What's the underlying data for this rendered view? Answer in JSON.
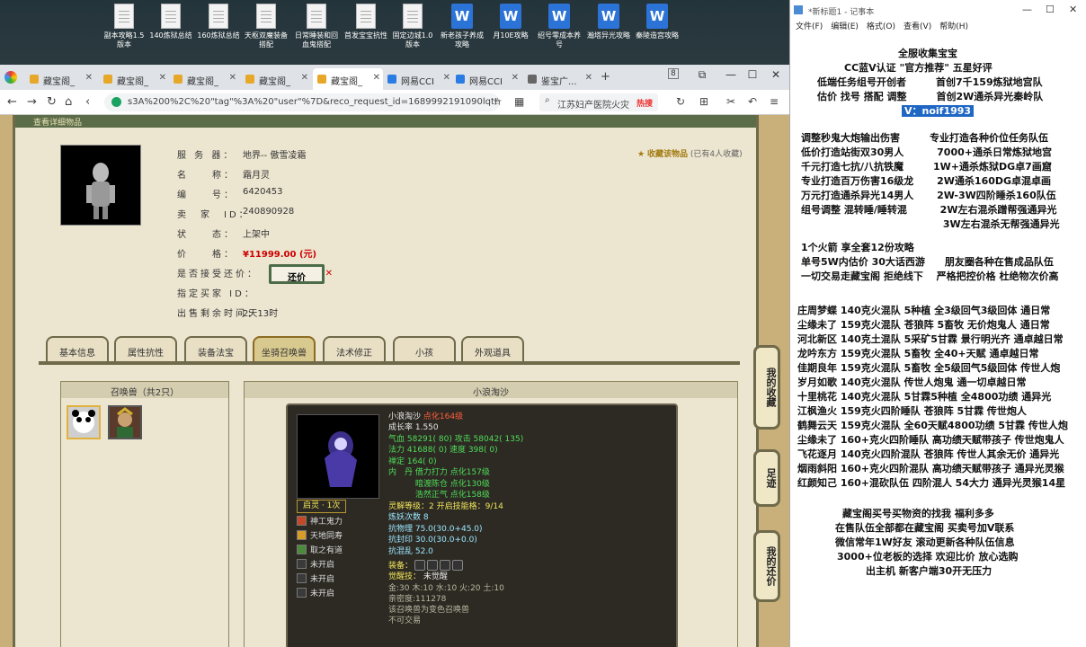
{
  "desktop": {
    "icons": [
      {
        "label": "副本攻略1.5版本",
        "kind": "doc"
      },
      {
        "label": "140炼狱总结",
        "kind": "doc"
      },
      {
        "label": "160炼狱总结",
        "kind": "doc"
      },
      {
        "label": "天枢双魔装备搭配",
        "kind": "doc"
      },
      {
        "label": "日常睡装和回血鬼搭配",
        "kind": "doc"
      },
      {
        "label": "首发宝宝抗性",
        "kind": "doc"
      },
      {
        "label": "固定边城1.0版本",
        "kind": "doc"
      },
      {
        "label": "新老孩子养成攻略",
        "kind": "word"
      },
      {
        "label": "月10E攻略",
        "kind": "word"
      },
      {
        "label": "绍号零成本养号",
        "kind": "word"
      },
      {
        "label": "瀚塔异光攻略",
        "kind": "word"
      },
      {
        "label": "秦陵造宫攻略",
        "kind": "word"
      }
    ]
  },
  "browser": {
    "tabs": [
      {
        "label": "藏宝阁_"
      },
      {
        "label": "藏宝阁_"
      },
      {
        "label": "藏宝阁_"
      },
      {
        "label": "藏宝阁_"
      },
      {
        "label": "藏宝阁_"
      },
      {
        "label": "网易CCI"
      },
      {
        "label": "网易CCI"
      },
      {
        "label": "鉴宝广..."
      }
    ],
    "active_tab": 4,
    "tab_count_badge": "8",
    "url": "s3A%200%2C%20\"tag\"%3A%20\"user\"%7D&reco_request_id=1689992191090lqtHb",
    "search_text": "江苏妇产医院火灾",
    "hot_label": "热搜"
  },
  "page": {
    "subheader": "查看详细物品",
    "favorite": {
      "label": "收藏该物品",
      "count_text": "(已有4人收藏)"
    },
    "fields": [
      {
        "label": "服 务 器：",
        "value": "地界-- 傲雪凌霜"
      },
      {
        "label": "名　　称：",
        "value": "霜月灵"
      },
      {
        "label": "编　　号：",
        "value": "6420453"
      },
      {
        "label": "卖　家　ID：",
        "value": "240890928"
      },
      {
        "label": "状　　态：",
        "value": "上架中"
      },
      {
        "label": "价　　格：",
        "value": "¥11999.00 (元)"
      },
      {
        "label": "是否接受还价：",
        "value": ""
      },
      {
        "label": "指定买家 ID：",
        "value": ""
      },
      {
        "label": "出售剩余时间：",
        "value": "2天13时"
      }
    ],
    "offer_button": "还价",
    "tabs": [
      "基本信息",
      "属性抗性",
      "装备法宝",
      "坐骑召唤兽",
      "法术修正",
      "小孩",
      "外观道具"
    ],
    "active_tab": 3,
    "left_panel_title": "召唤兽（共2只）",
    "right_panel_title": "小浪淘沙",
    "pet": {
      "name_line": "小浪淘沙",
      "name_tag": "点化164级",
      "lines": [
        {
          "text": "成长率 1.550",
          "cls": "w"
        },
        {
          "text": "气血 58291( 80) 攻击 58042( 135)",
          "cls": "g"
        },
        {
          "text": "法力 41688( 0) 速度 398( 0)",
          "cls": "g"
        },
        {
          "text": "禅定 164( 0)",
          "cls": "g"
        },
        {
          "text": "内　丹  借力打力 点化157级",
          "cls": "g"
        },
        {
          "text": "　　　 暗渡陈仓 点化130级",
          "cls": "g"
        },
        {
          "text": "　　　 浩然正气 点化158级",
          "cls": "g"
        },
        {
          "text": "灵解等级：2 开启技能格：9/14",
          "cls": "y"
        },
        {
          "text": "炼妖次数 8",
          "cls": "c"
        },
        {
          "text": "抗物理 75.0(30.0+45.0)",
          "cls": "c"
        },
        {
          "text": "抗封印 30.0(30.0+0.0)",
          "cls": "c"
        },
        {
          "text": "抗混乱 52.0",
          "cls": "c"
        }
      ],
      "awaken_title": "启灵 · 1次",
      "skills": [
        "神工鬼力",
        "天地同寿",
        "取之有道",
        "未开启",
        "未开启",
        "未开启"
      ],
      "equip_label": "装备：",
      "awaken_skill_label": "觉醒技：",
      "awaken_skill_value": "未觉醒",
      "bottom_lines": [
        "金:30 木:10 水:10 火:20 土:10",
        "亲密度:111278",
        "该召唤兽为变色召唤兽",
        "不可交易"
      ]
    },
    "side_buttons": [
      "我的收藏",
      "足迹",
      "我的还价"
    ]
  },
  "notepad": {
    "title": "*新标题1 - 记事本",
    "menu": [
      "文件(F)",
      "编辑(E)",
      "格式(O)",
      "查看(V)",
      "帮助(H)"
    ],
    "header_lines": [
      "全服收集宝宝",
      "CC蓝V认证 \"官方推荐\" 五星好评",
      "低端任务组号开创者　　　首创7千159炼狱地宫队",
      "估价 找号 搭配 调整　　　首创2W通杀异光秦岭队"
    ],
    "contact": "V：noif1993",
    "block1": [
      "调整秒鬼大炮输出伤害　　　专业打造各种价位任务队伍",
      "低价打造站街双30男人　　　 7000+通杀日常炼狱地宫",
      "千元打造七抗/八抗铁魔　　　1W+通杀炼狱DG卓7画窟",
      "专业打造百万伤害16级龙　　 2W通杀160DG卓混卓画",
      "万元打造通杀异光14男人　　 2W-3W四阶睡杀160队伍",
      "组号调整 混转睡/睡转混　　　 2W左右混杀蹭帮强通异光",
      "　　　　　　　　　　　　　　 3W左右混杀无帮强通异光"
    ],
    "block2": [
      "1个火箭 享全套12份攻略",
      "单号5W内估价 30大话西游　　朋友圈各种在售成品队伍",
      "一切交易走藏宝阁 拒绝线下　 严格把控价格 杜绝物次价高"
    ],
    "block3": [
      "庄周梦蝶 140克火混队 5种植 全3级回气3级回体 通日常",
      "尘缘未了 159克火混队 苍狼阵 5畜牧 无价炮鬼人 通日常",
      "河北新区 140克土混队 5采矿5甘霖 景行明光齐 通卓越日常",
      "龙吟东方 159克火混队 5畜牧 全40+天赋 通卓越日常",
      "佳期良年 159克火混队 5畜牧 全5级回气5级回体 传世人炮",
      "岁月如歌 140克火混队 传世人炮鬼 通一切卓越日常",
      "十里桃花 140克火混队 5甘霖5种植 全4800功绩 通异光",
      "江枫渔火 159克火四阶睡队 苍狼阵 5甘霖 传世炮人",
      "鹤舞云天 159克火混队 全60天赋4800功绩 5甘霖 传世人炮",
      "尘缘未了 160+克火四阶睡队 高功绩天赋带孩子 传世炮鬼人",
      "飞花逐月 140克火四阶混队 苍狼阵 传世人其余无价 通异光",
      "烟雨斜阳 160+克火四阶混队 高功绩天赋带孩子 通异光灵猴",
      "红颜知己 160+混砍队伍 四阶混人 54大力 通异光灵猴14星"
    ],
    "block4": [
      "藏宝阁买号买物资的找我 福利多多",
      "在售队伍全部都在藏宝阁 买卖号加V联系",
      "微信常年1W好友 滚动更新各种队伍信息",
      "3000+位老板的选择 欢迎比价 放心选购",
      "出主机 新客户端30开无压力"
    ]
  }
}
